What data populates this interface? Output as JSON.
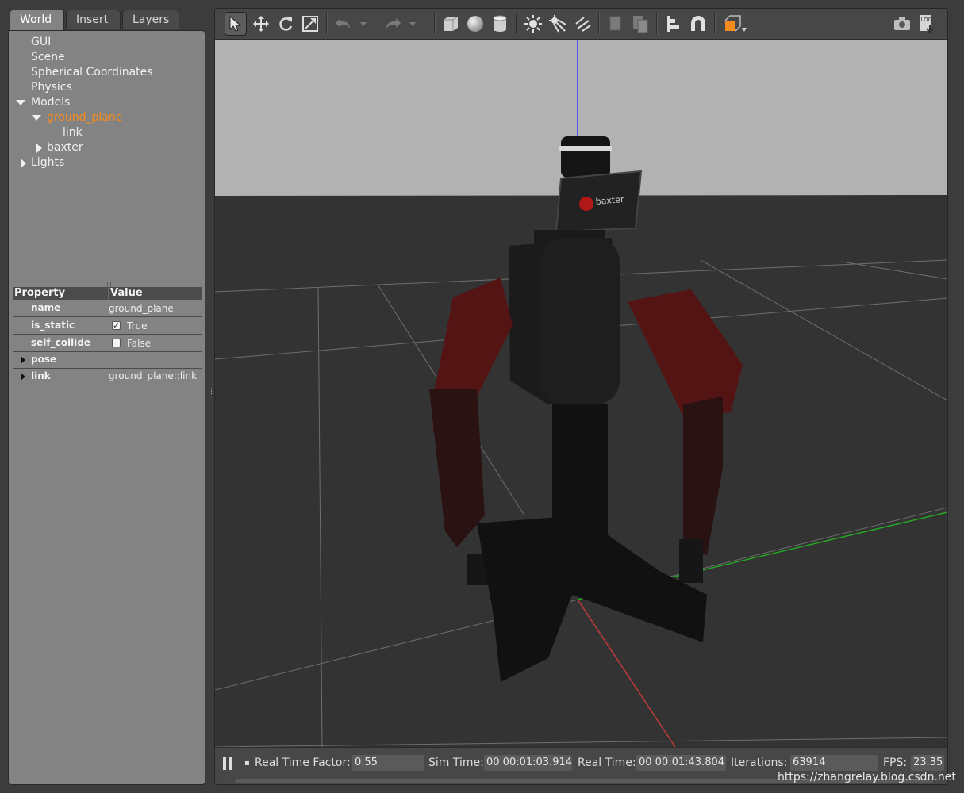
{
  "left_panel": {
    "tabs": [
      {
        "label": "World",
        "active": true
      },
      {
        "label": "Insert",
        "active": false
      },
      {
        "label": "Layers",
        "active": false
      }
    ],
    "tree": {
      "gui": "GUI",
      "scene": "Scene",
      "spherical": "Spherical Coordinates",
      "physics": "Physics",
      "models": "Models",
      "ground_plane": "ground_plane",
      "link": "link",
      "baxter": "baxter",
      "lights": "Lights"
    },
    "properties": {
      "header_property": "Property",
      "header_value": "Value",
      "rows": [
        {
          "name": "name",
          "value": "ground_plane"
        },
        {
          "name": "is_static",
          "value": "True",
          "checked": true
        },
        {
          "name": "self_collide",
          "value": "False",
          "checked": false
        }
      ],
      "groups": [
        {
          "name": "pose",
          "value": ""
        },
        {
          "name": "link",
          "value": "ground_plane::link"
        }
      ]
    }
  },
  "toolbar": {
    "icons": [
      "select-icon",
      "translate-icon",
      "rotate-icon",
      "scale-icon",
      "undo-icon",
      "undo-dropdown-icon",
      "redo-icon",
      "redo-dropdown-icon",
      "box-icon",
      "sphere-icon",
      "cylinder-icon",
      "point-light-icon",
      "spot-light-icon",
      "directional-light-icon",
      "copy-icon",
      "paste-icon",
      "align-icon",
      "snap-icon",
      "view-angle-icon",
      "screenshot-icon",
      "log-icon"
    ],
    "log_label": "LOG"
  },
  "status": {
    "rtf_label": "Real Time Factor:",
    "rtf_value": "0.55",
    "sim_label": "Sim Time:",
    "sim_value": "00 00:01:03.914",
    "real_label": "Real Time:",
    "real_value": "00 00:01:43.804",
    "iter_label": "Iterations:",
    "iter_value": "63914",
    "fps_label": "FPS:",
    "fps_value": "23.35"
  },
  "scene": {
    "robot_screen_text": "baxter"
  },
  "watermark": "https://zhangrelay.blog.csdn.net",
  "colors": {
    "selection_orange": "#f58a1f",
    "sky": "#b2b2b2",
    "ground": "#333333",
    "robot_red": "#5a1414"
  }
}
